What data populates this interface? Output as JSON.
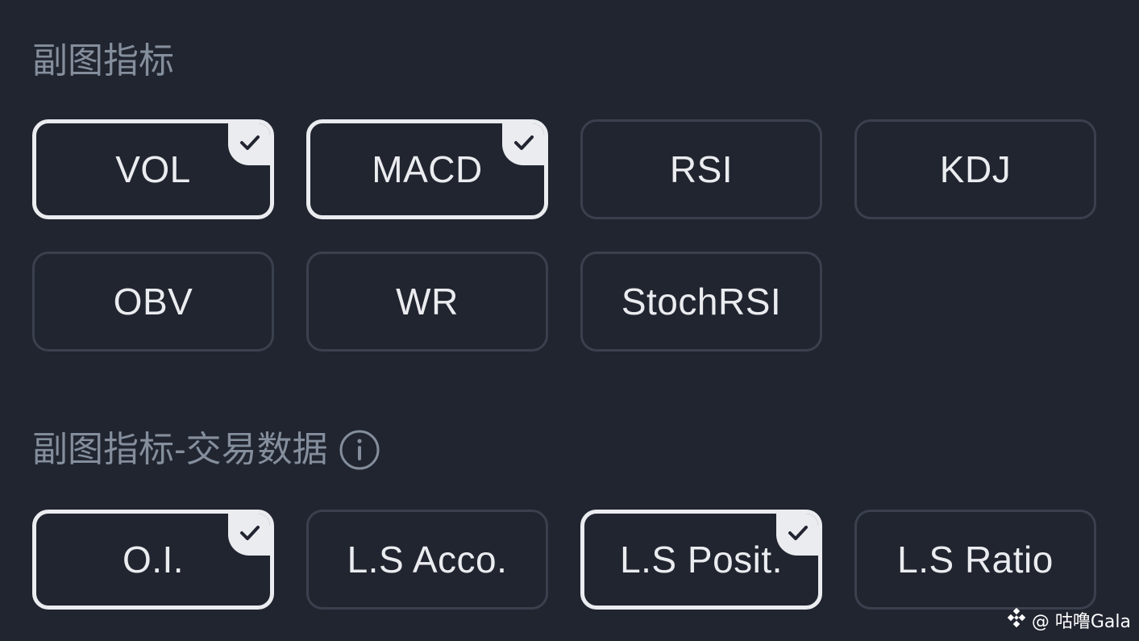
{
  "sections": [
    {
      "title": "副图指标",
      "has_info": false,
      "items": [
        {
          "label": "VOL",
          "selected": true
        },
        {
          "label": "MACD",
          "selected": true
        },
        {
          "label": "RSI",
          "selected": false
        },
        {
          "label": "KDJ",
          "selected": false
        },
        {
          "label": "OBV",
          "selected": false
        },
        {
          "label": "WR",
          "selected": false
        },
        {
          "label": "StochRSI",
          "selected": false
        }
      ]
    },
    {
      "title": "副图指标-交易数据",
      "has_info": true,
      "info_icon": "info-icon",
      "items": [
        {
          "label": "O.I.",
          "selected": true
        },
        {
          "label": "L.S Acco.",
          "selected": false
        },
        {
          "label": "L.S Posit.",
          "selected": true
        },
        {
          "label": "L.S Ratio",
          "selected": false
        }
      ]
    }
  ],
  "watermark": {
    "icon": "binance-logo-icon",
    "text": "@ 咕噜Gala"
  },
  "colors": {
    "background": "#212530",
    "selected_border": "#eaecef",
    "unselected_border": "#3a404d",
    "title": "#848e9c",
    "text": "#eaecef"
  }
}
